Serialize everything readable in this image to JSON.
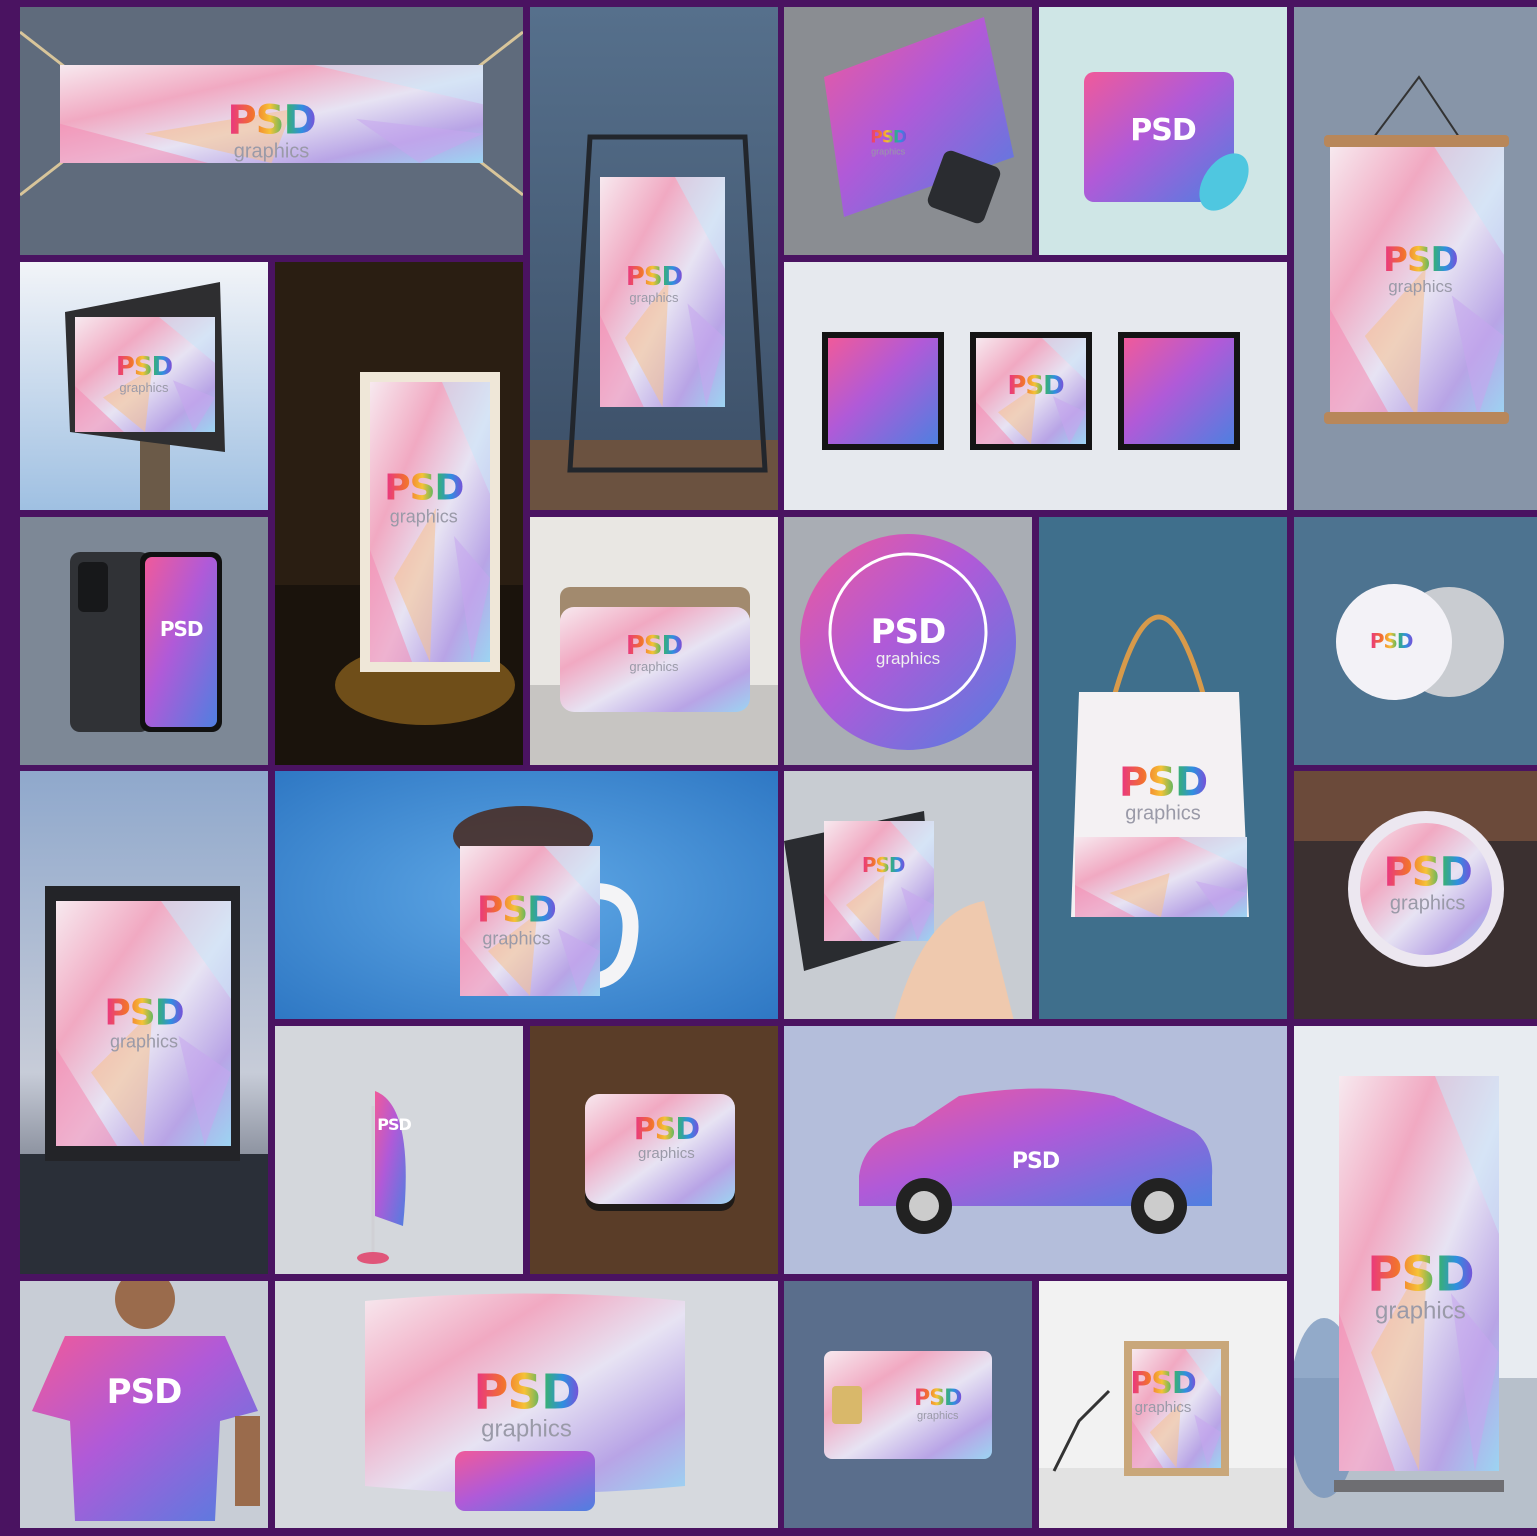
{
  "colors": {
    "frame_background": "#4a1361",
    "wordmark_gradient": [
      "#e8308a",
      "#f2712f",
      "#f6c236",
      "#39b36b",
      "#2f8fe0",
      "#7a4fd8"
    ]
  },
  "logo": {
    "brand": "PSD",
    "sub": "graphics"
  },
  "mockups": [
    {
      "id": "vinyl-banner",
      "subject": "stretched vinyl banner",
      "icon": "banner-icon",
      "logo_sub": true
    },
    {
      "id": "hanging-frame-poster",
      "subject": "poster in standing hanging frame",
      "icon": "frame-icon",
      "logo_sub": true
    },
    {
      "id": "laptop-skin",
      "subject": "laptop skin on sofa",
      "icon": "laptop-icon",
      "logo_sub": true
    },
    {
      "id": "mouse-pad",
      "subject": "mouse pad with mouse",
      "icon": "mousepad-icon",
      "logo_sub": false
    },
    {
      "id": "wall-scroll-poster",
      "subject": "wall scroll poster",
      "icon": "scroll-icon",
      "logo_sub": true
    },
    {
      "id": "billboard",
      "subject": "outdoor billboard",
      "icon": "billboard-icon",
      "logo_sub": true
    },
    {
      "id": "bus-stop-sign",
      "subject": "bus stop sign at night",
      "icon": "lightbox-icon",
      "logo_sub": true
    },
    {
      "id": "three-frames",
      "subject": "three square wall frames",
      "icon": "frames-icon",
      "logo_sub": false
    },
    {
      "id": "smartphone",
      "subject": "smartphone front and back",
      "icon": "phone-icon",
      "logo_sub": false
    },
    {
      "id": "pillow",
      "subject": "pillow on bed",
      "icon": "pillow-icon",
      "logo_sub": true
    },
    {
      "id": "round-sign",
      "subject": "round sign held by person",
      "icon": "circle-sign-icon",
      "logo_sub": true
    },
    {
      "id": "tote-bag",
      "subject": "hanging tote bag",
      "icon": "tote-bag-icon",
      "logo_sub": true
    },
    {
      "id": "pin-button",
      "subject": "pin button badge",
      "icon": "badge-icon",
      "logo_sub": false
    },
    {
      "id": "outdoor-poster",
      "subject": "outdoor poster stand",
      "icon": "poster-stand-icon",
      "logo_sub": true
    },
    {
      "id": "mug",
      "subject": "mug with coffee splash",
      "icon": "mug-icon",
      "logo_sub": true
    },
    {
      "id": "flyer-in-hand",
      "subject": "flyer held in hand",
      "icon": "flyer-icon",
      "logo_sub": false
    },
    {
      "id": "round-wall-sign",
      "subject": "round wall sign",
      "icon": "wall-sign-icon",
      "logo_sub": true
    },
    {
      "id": "feather-flag",
      "subject": "feather flag",
      "icon": "flag-icon",
      "logo_sub": false
    },
    {
      "id": "coaster",
      "subject": "coaster on wooden table",
      "icon": "coaster-icon",
      "logo_sub": true
    },
    {
      "id": "car-wrap",
      "subject": "car wrap",
      "icon": "car-icon",
      "logo_sub": false
    },
    {
      "id": "roll-up-banner",
      "subject": "roll-up banner stand",
      "icon": "rollup-icon",
      "logo_sub": true
    },
    {
      "id": "t-shirt",
      "subject": "t-shirt on man",
      "icon": "tshirt-icon",
      "logo_sub": false
    },
    {
      "id": "trade-show-booth",
      "subject": "trade show pop-up booth",
      "icon": "booth-icon",
      "logo_sub": true
    },
    {
      "id": "sim-card",
      "subject": "sim card",
      "icon": "simcard-icon",
      "logo_sub": true
    },
    {
      "id": "desk-frame",
      "subject": "photo frame on desk with lamp",
      "icon": "desk-frame-icon",
      "logo_sub": true
    }
  ]
}
